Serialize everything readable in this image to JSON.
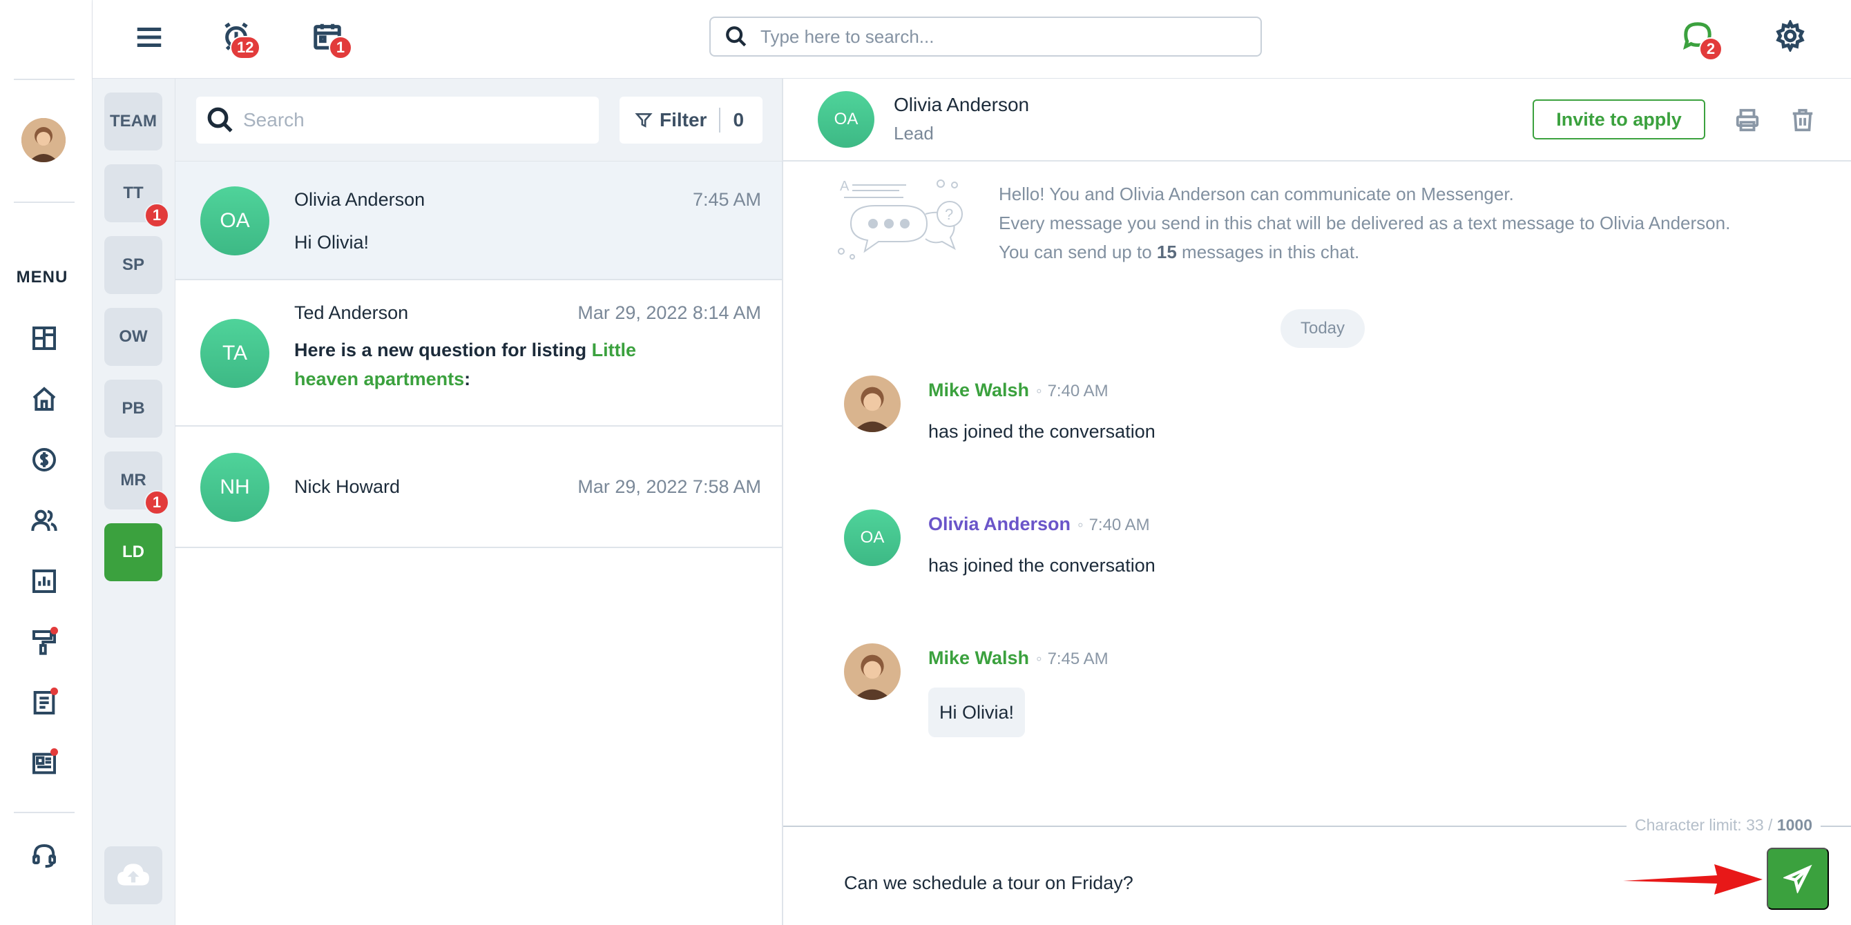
{
  "rail": {
    "menu_label": "MENU",
    "nav_items": [
      {
        "icon": "dashboard-icon"
      },
      {
        "icon": "home-icon"
      },
      {
        "icon": "dollar-icon"
      },
      {
        "icon": "users-icon"
      },
      {
        "icon": "chart-icon"
      },
      {
        "icon": "paint-roller-icon",
        "dot": true
      },
      {
        "icon": "document-icon",
        "dot": true
      },
      {
        "icon": "newspaper-icon",
        "dot": true
      }
    ],
    "support_icon": "headset-icon"
  },
  "topbar": {
    "alarm_badge": "12",
    "calendar_badge": "1",
    "search_placeholder": "Type here to search...",
    "chat_badge": "2"
  },
  "channels": [
    {
      "label": "TEAM",
      "badge": ""
    },
    {
      "label": "TT",
      "badge": "1"
    },
    {
      "label": "SP",
      "badge": ""
    },
    {
      "label": "OW",
      "badge": ""
    },
    {
      "label": "PB",
      "badge": ""
    },
    {
      "label": "MR",
      "badge": "1"
    },
    {
      "label": "LD",
      "badge": "",
      "active": true
    }
  ],
  "conv_list": {
    "search_placeholder": "Search",
    "filter_label": "Filter",
    "filter_count": "0",
    "items": [
      {
        "initials": "OA",
        "name": "Olivia Anderson",
        "time": "7:45 AM",
        "message": "Hi Olivia!"
      },
      {
        "initials": "TA",
        "name": "Ted Anderson",
        "time": "Mar 29, 2022 8:14 AM",
        "message_prefix": "Here is a new question for listing ",
        "message_highlight": "Little heaven apartments",
        "message_suffix": ":"
      },
      {
        "initials": "NH",
        "name": "Nick Howard",
        "time": "Mar 29, 2022 7:58 AM"
      }
    ]
  },
  "chat": {
    "contact_initials": "OA",
    "contact_name": "Olivia Anderson",
    "contact_role": "Lead",
    "invite_label": "Invite to apply",
    "intro_line1": "Hello! You and Olivia Anderson can communicate on Messenger.",
    "intro_line2": "Every message you send in this chat will be delivered as a text message to Olivia Anderson.",
    "intro_line3_prefix": "You can send up to ",
    "intro_line3_count": "15",
    "intro_line3_suffix": " messages in this chat.",
    "date_divider": "Today",
    "messages": [
      {
        "sender": "Mike Walsh",
        "time": "7:40 AM",
        "body": "has joined the conversation"
      },
      {
        "sender": "Olivia Anderson",
        "initials": "OA",
        "time": "7:40 AM",
        "body": "has joined the conversation"
      },
      {
        "sender": "Mike Walsh",
        "time": "7:45 AM",
        "body": "Hi Olivia!"
      }
    ],
    "char_limit_label": "Character limit: 33 / ",
    "char_limit_max": "1000",
    "composer_value": "Can we schedule a tour on Friday?"
  },
  "colors": {
    "accent": "#3ba13e",
    "badge": "#e23b3b",
    "avatar": "#45c48f",
    "purple": "#6a55c9"
  }
}
